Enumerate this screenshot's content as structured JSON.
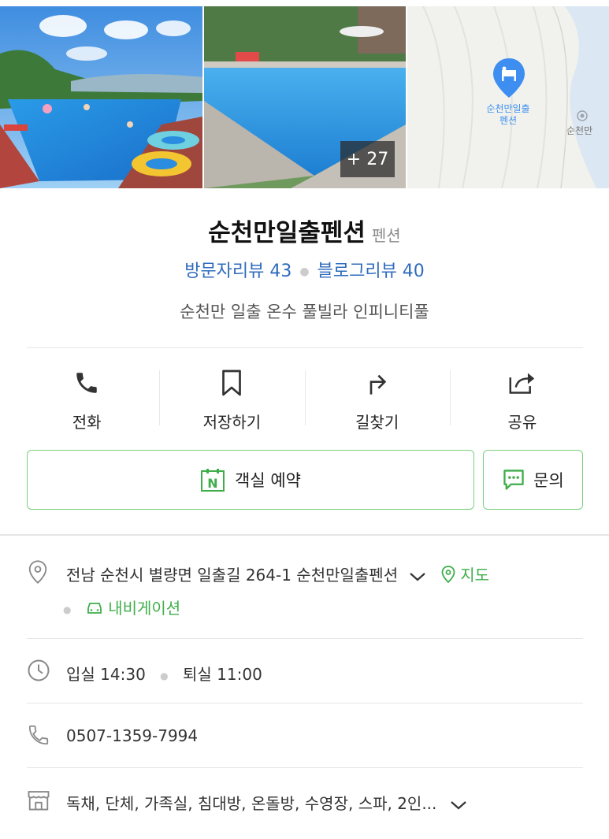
{
  "photos": {
    "more_count": "+ 27",
    "map_place_label_1": "순천만일출",
    "map_place_label_2": "펜션",
    "map_area_label": "순천만"
  },
  "place": {
    "name": "순천만일출펜션",
    "category": "펜션",
    "visitor_reviews": "방문자리뷰 43",
    "blog_reviews": "블로그리뷰 40",
    "description": "순천만 일출 온수 풀빌라 인피니티풀"
  },
  "actions": {
    "call": "전화",
    "save": "저장하기",
    "directions": "길찾기",
    "share": "공유"
  },
  "buttons": {
    "book": "객실 예약",
    "ask": "문의",
    "npay_letter": "N"
  },
  "info": {
    "address": "전남 순천시 별량면 일출길 264-1 순천만일출펜션",
    "map_link": "지도",
    "navigation_link": "내비게이션",
    "checkin": "입실 14:30",
    "checkout": "퇴실 11:00",
    "phone": "0507-1359-7994",
    "amenities": "독채, 단체, 가족실, 침대방, 온돌방, 수영장, 스파, 2인..."
  },
  "colors": {
    "link_blue": "#2f6bbd",
    "green": "#3fae4a",
    "map_pin": "#3d8ef0"
  }
}
